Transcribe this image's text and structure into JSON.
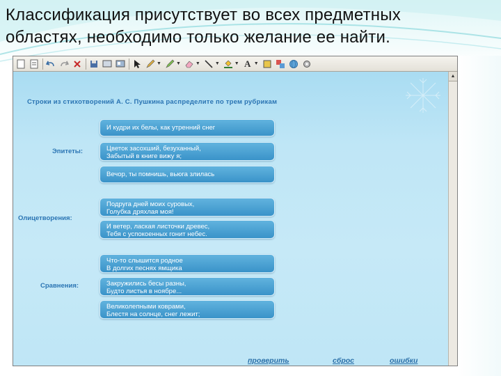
{
  "slide": {
    "title_line1": "Классификация присутствует во всех предметных",
    "title_line2": "областях, необходимо только желание ее найти."
  },
  "colors": {
    "canvas_bg": "#bfe6f6",
    "card_bg": "#4aa3d4",
    "label_blue": "#2a74b3",
    "slide_accent": "#5fc7cf"
  },
  "toolbar": {
    "icons": [
      "page-icon",
      "document-icon",
      "undo-icon",
      "redo-icon",
      "delete-icon",
      "save-icon",
      "screen-icon",
      "screen2-icon",
      "pointer-icon",
      "pen-icon",
      "marker-icon",
      "eraser-icon",
      "line-icon",
      "fill-icon",
      "text-icon",
      "color-icon",
      "shapes-icon",
      "globe-icon",
      "settings-icon"
    ]
  },
  "exercise": {
    "heading": "Строки из стихотворений А. С. Пушкина распределите по трем рубрикам",
    "categories": [
      {
        "label": "Эпитеты:"
      },
      {
        "label": "Олицетворения:"
      },
      {
        "label": "Сравнения:"
      }
    ],
    "cards": [
      {
        "text": "И кудри их белы, как утренний снег"
      },
      {
        "text": "Цветок засохший, безуханный,\nЗабытый в книге вижу я;"
      },
      {
        "text": "Вечор, ты помнишь, вьюга злилась"
      },
      {
        "text": "Подруга дней моих суровых,\nГолубка дряхлая моя!"
      },
      {
        "text": "И ветер, лаская листочки древес,\nТебя с успокоенных гонит небес."
      },
      {
        "text": "Что-то слышится родное\nВ долгих песнях ямщика"
      },
      {
        "text": "Закружились бесы разны,\nБудто листья в ноябре..."
      },
      {
        "text": "Великолепными коврами,\nБлестя на солнце, снег лежит;"
      }
    ],
    "buttons": {
      "check": "проверить",
      "reset": "сброс",
      "errors": "ошибки"
    }
  }
}
